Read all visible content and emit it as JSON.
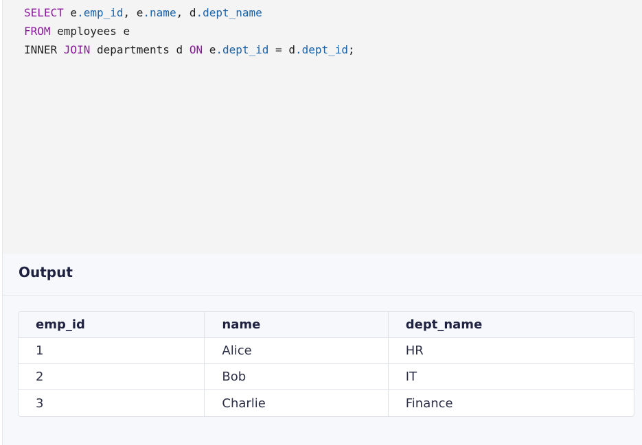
{
  "editor": {
    "lines": [
      [
        {
          "t": "SELECT",
          "c": "kw"
        },
        {
          "t": " e",
          "c": "plain"
        },
        {
          "t": ".emp_id",
          "c": "prop"
        },
        {
          "t": ", e",
          "c": "plain"
        },
        {
          "t": ".name",
          "c": "prop"
        },
        {
          "t": ", d",
          "c": "plain"
        },
        {
          "t": ".dept_name",
          "c": "prop"
        }
      ],
      [
        {
          "t": "FROM",
          "c": "kw"
        },
        {
          "t": " employees e",
          "c": "plain"
        }
      ],
      [
        {
          "t": "INNER ",
          "c": "plain"
        },
        {
          "t": "JOIN",
          "c": "kw"
        },
        {
          "t": " departments d ",
          "c": "plain"
        },
        {
          "t": "ON",
          "c": "kw"
        },
        {
          "t": " e",
          "c": "plain"
        },
        {
          "t": ".dept_id",
          "c": "prop"
        },
        {
          "t": " = d",
          "c": "plain"
        },
        {
          "t": ".dept_id",
          "c": "prop"
        },
        {
          "t": ";",
          "c": "plain"
        }
      ]
    ]
  },
  "output": {
    "title": "Output",
    "columns": [
      "emp_id",
      "name",
      "dept_name"
    ],
    "rows": [
      [
        "1",
        "Alice",
        "HR"
      ],
      [
        "2",
        "Bob",
        "IT"
      ],
      [
        "3",
        "Charlie",
        "Finance"
      ]
    ]
  },
  "colors": {
    "keyword": "#8a1a9b",
    "property": "#1a63a8",
    "editor_bg": "#f4f4f4",
    "output_bg": "#f7f8fb",
    "title": "#1e2140"
  }
}
